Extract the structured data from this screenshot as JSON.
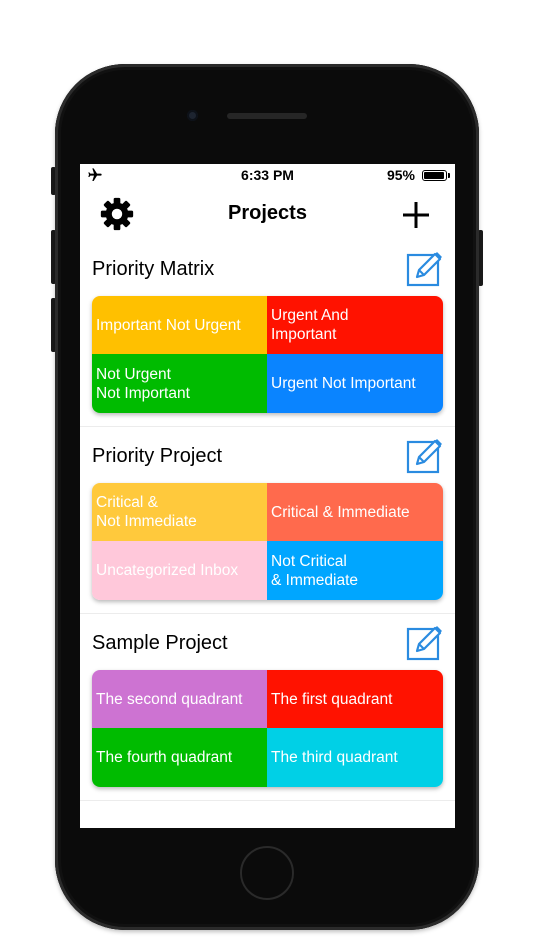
{
  "status_bar": {
    "time": "6:33 PM",
    "battery_percent": "95%",
    "battery_level": 0.95,
    "airplane_icon": "airplane-icon"
  },
  "nav": {
    "title": "Projects",
    "settings_icon": "gear-icon",
    "add_icon": "plus-icon"
  },
  "colors": {
    "yellow": "#FFC000",
    "red": "#FF1200",
    "green": "#00BB00",
    "blue": "#0A84FF",
    "amber": "#FFC93C",
    "coral": "#FF6A4D",
    "pink": "#FFC8DA",
    "sky": "#00A6FF",
    "purple": "#CD73D2",
    "cyan": "#00D0E6",
    "edit_icon": "#2A8BE0"
  },
  "projects": [
    {
      "name": "Priority Matrix",
      "edit_icon": "edit-icon",
      "quadrants": [
        {
          "label": "Important Not Urgent",
          "color": "#FFC000"
        },
        {
          "label": "Urgent And\nImportant",
          "color": "#FF1200"
        },
        {
          "label": "Not Urgent\nNot Important",
          "color": "#00BB00"
        },
        {
          "label": "Urgent Not Important",
          "color": "#0A84FF"
        }
      ]
    },
    {
      "name": "Priority Project",
      "edit_icon": "edit-icon",
      "quadrants": [
        {
          "label": "Critical &\nNot Immediate",
          "color": "#FFC93C"
        },
        {
          "label": "Critical & Immediate",
          "color": "#FF6A4D"
        },
        {
          "label": "Uncategorized Inbox",
          "color": "#FFC8DA"
        },
        {
          "label": "Not Critical\n& Immediate",
          "color": "#00A6FF"
        }
      ]
    },
    {
      "name": "Sample Project",
      "edit_icon": "edit-icon",
      "quadrants": [
        {
          "label": "The second quadrant",
          "color": "#CD73D2"
        },
        {
          "label": "The first quadrant",
          "color": "#FF1200"
        },
        {
          "label": "The fourth quadrant",
          "color": "#00BB00"
        },
        {
          "label": "The third quadrant",
          "color": "#00D0E6"
        }
      ]
    }
  ]
}
